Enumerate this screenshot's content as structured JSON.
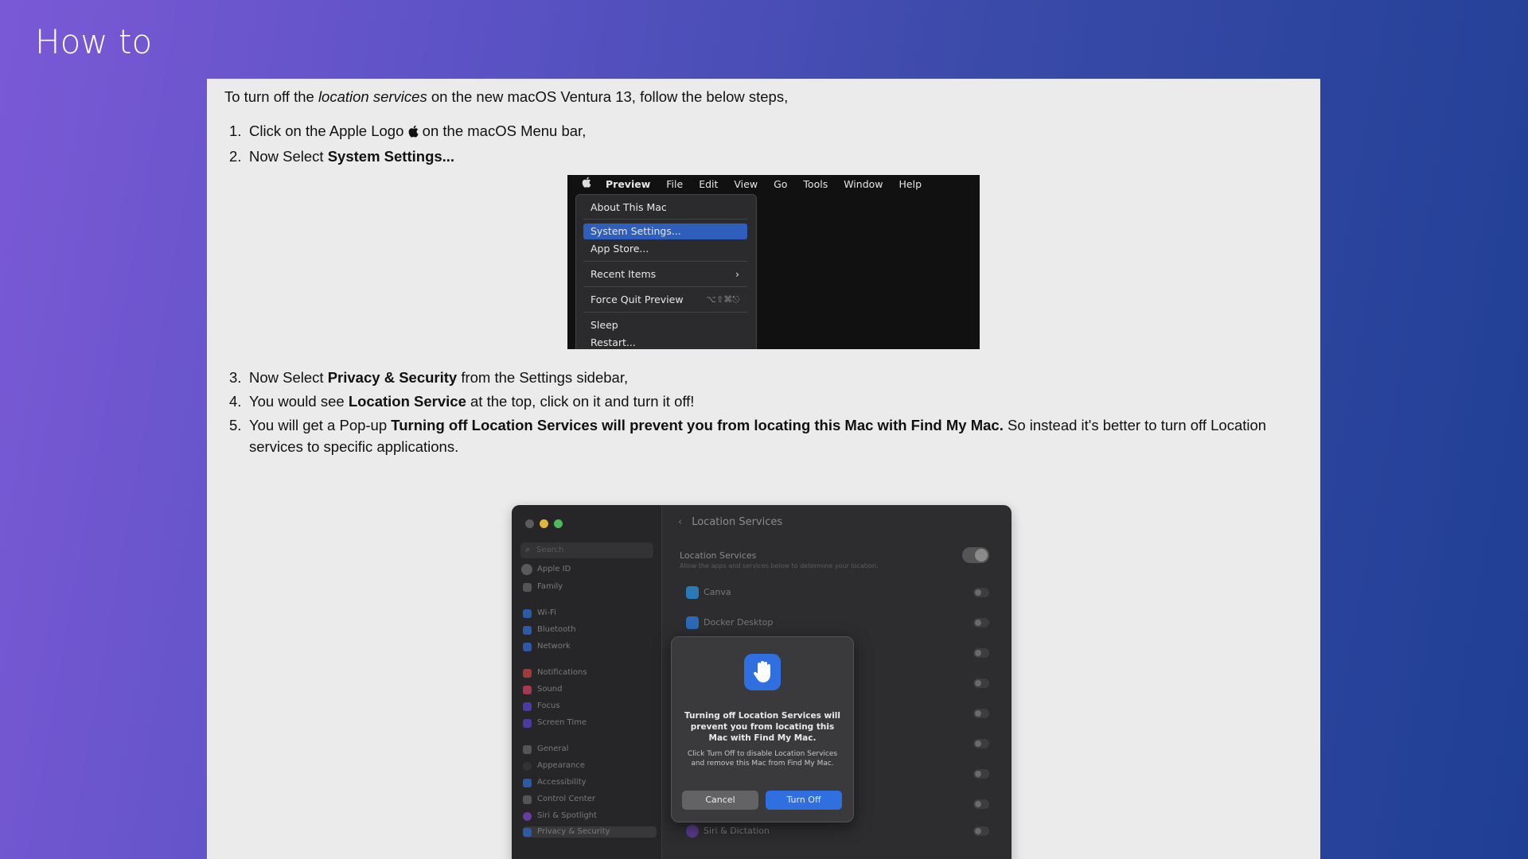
{
  "slide": {
    "title": "How to"
  },
  "intro": {
    "before": "To turn off the ",
    "italic": "location services",
    "after": " on the new macOS Ventura 13, follow the below steps,"
  },
  "steps_a": [
    {
      "num": "1.",
      "text1": "Click on the Apple Logo ",
      "icon": "apple-logo",
      "text2": " on the macOS Menu bar,"
    },
    {
      "num": "2.",
      "text1": "Now Select ",
      "bold": "System Settings..."
    }
  ],
  "menu_screenshot": {
    "apple": "",
    "menubar": [
      "Preview",
      "File",
      "Edit",
      "View",
      "Go",
      "Tools",
      "Window",
      "Help"
    ],
    "items": {
      "about": "About This Mac",
      "system_settings": "System Settings...",
      "app_store": "App Store...",
      "recent_items": "Recent Items",
      "recent_arrow": "›",
      "force_quit": "Force Quit Preview",
      "force_quit_shortcut": "⌥⇧⌘⎋",
      "sleep": "Sleep",
      "restart": "Restart..."
    }
  },
  "steps_b": [
    {
      "num": "3.",
      "text1": "Now Select ",
      "bold": "Privacy & Security",
      "text2": " from the Settings sidebar,"
    },
    {
      "num": "4.",
      "text1": "You would see ",
      "bold": "Location Service",
      "text2": " at the top, click on it and turn it off!"
    },
    {
      "num": "5.",
      "text1": "You will get a Pop-up ",
      "bold": "Turning off Location Services will prevent you from locating this Mac with Find My Mac.",
      "text2": " So instead it's better to turn off Location services to specific applications."
    }
  ],
  "settings_screenshot": {
    "search_placeholder": "Search",
    "sidebar": {
      "apple_id": "Apple ID",
      "family": "Family",
      "wifi": "Wi-Fi",
      "bluetooth": "Bluetooth",
      "network": "Network",
      "notifications": "Notifications",
      "sound": "Sound",
      "focus": "Focus",
      "screen_time": "Screen Time",
      "general": "General",
      "appearance": "Appearance",
      "accessibility": "Accessibility",
      "control_center": "Control Center",
      "siri_spotlight": "Siri & Spotlight",
      "privacy_security": "Privacy & Security"
    },
    "pane_title": "Location Services",
    "location_services_label": "Location Services",
    "location_services_sub": "Allow the apps and services below to determine your location.",
    "apps": {
      "canva": "Canva",
      "docker": "Docker Desktop",
      "siri": "Siri & Dictation"
    },
    "dialog": {
      "title": "Turning off Location Services will prevent you from locating this Mac with Find My Mac.",
      "body": "Click Turn Off to disable Location Services and remove this Mac from Find My Mac.",
      "cancel": "Cancel",
      "turn_off": "Turn Off"
    }
  }
}
